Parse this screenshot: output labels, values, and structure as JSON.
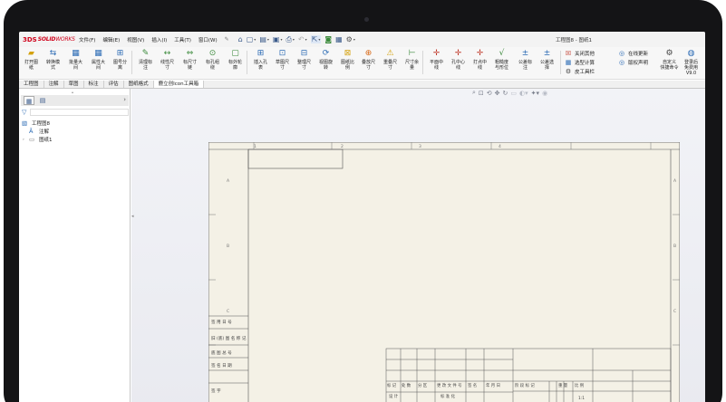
{
  "app": {
    "logo": "3DS",
    "logo_text_bold": "SOLID",
    "logo_text_light": "WORKS",
    "window_title": "工程图8 - 图纸1"
  },
  "menu": [
    "文件(F)",
    "编辑(E)",
    "视图(V)",
    "插入(I)",
    "工具(T)",
    "窗口(W)"
  ],
  "ribbon": {
    "buttons": [
      {
        "label1": "打开图",
        "label2": "纸",
        "icon": "folder-icon"
      },
      {
        "label1": "转换模",
        "label2": "式",
        "icon": "convert-icon"
      },
      {
        "label1": "批量大",
        "label2": "间",
        "icon": "batch-icon"
      },
      {
        "label1": "属性大",
        "label2": "间",
        "icon": "property-icon"
      },
      {
        "label1": "图号分",
        "label2": "离",
        "icon": "split-icon"
      },
      {
        "label1": "清理标",
        "label2": "注",
        "icon": "clean-icon"
      },
      {
        "label1": "线性尺",
        "label2": "寸",
        "icon": "linear-dim-icon"
      },
      {
        "label1": "标尺寸",
        "label2": "链",
        "icon": "chain-icon"
      },
      {
        "label1": "标孔组",
        "label2": "绕",
        "icon": "hole-icon"
      },
      {
        "label1": "标外轮",
        "label2": "廓",
        "icon": "outline-icon"
      },
      {
        "label1": "插入孔",
        "label2": "表",
        "icon": "hole-table-icon"
      },
      {
        "label1": "草图尺",
        "label2": "寸",
        "icon": "sketch-dim-icon"
      },
      {
        "label1": "整理尺",
        "label2": "寸",
        "icon": "arrange-dim-icon"
      },
      {
        "label1": "视图旋",
        "label2": "转",
        "icon": "rotate-view-icon"
      },
      {
        "label1": "图纸比",
        "label2": "例",
        "icon": "scale-icon"
      },
      {
        "label1": "叠放尺",
        "label2": "寸",
        "icon": "stack-dim-icon"
      },
      {
        "label1": "重叠尺",
        "label2": "寸",
        "icon": "overlap-dim-icon"
      },
      {
        "label1": "尺寸余",
        "label2": "量",
        "icon": "tolerance-icon"
      },
      {
        "label1": "平面中",
        "label2": "线",
        "icon": "plane-center-icon"
      },
      {
        "label1": "孔中心",
        "label2": "线",
        "icon": "hole-center-icon"
      },
      {
        "label1": "打点中",
        "label2": "线",
        "icon": "dot-center-icon"
      },
      {
        "label1": "粗糙度",
        "label2": "与形位",
        "icon": "roughness-icon"
      },
      {
        "label1": "公差标",
        "label2": "注",
        "icon": "tol-note-icon"
      },
      {
        "label1": "公差选",
        "label2": "择",
        "icon": "tol-select-icon"
      }
    ],
    "side1": [
      "关闭其他",
      "选型计算",
      "皮工具栏"
    ],
    "side2": [
      "在线更新",
      "版权声明"
    ],
    "side3": [
      {
        "label1": "自定义",
        "label2": "快捷命令",
        "icon": "custom-cmd-icon"
      },
      {
        "label1": "登录后",
        "label2": "免费用",
        "label3": "V9.0",
        "icon": "login-icon"
      }
    ]
  },
  "tabs": [
    "工程图",
    "注解",
    "草图",
    "标注",
    "评估",
    "图纸格式",
    "鹿立创Icon工具箱"
  ],
  "active_tab": 6,
  "tree": {
    "root": "工程图8",
    "items": [
      "注解",
      "图纸1"
    ]
  },
  "titleblock": {
    "left_labels": [
      "签 用 日 号",
      "旧 (底) 图 名 称 记",
      "底 图 总 号",
      "签 名 日 期",
      "签 字"
    ],
    "head_row": [
      "标 记",
      "处 数",
      "分 区",
      "更 改 文 件 号",
      "签 名",
      "年 月 日"
    ],
    "mid_row": [
      "阶 段 标 记",
      "重 量",
      "比 例"
    ],
    "row2": [
      "设 计",
      "标 准 化"
    ],
    "scale": "1:1"
  },
  "sheet": {
    "col_marks": [
      "1",
      "2",
      "3",
      "4"
    ],
    "row_marks": [
      "A",
      "B",
      "C"
    ]
  },
  "colors": {
    "brand": "#d0021b",
    "accent": "#2d6cb5",
    "sheet": "#f4f1e6"
  }
}
